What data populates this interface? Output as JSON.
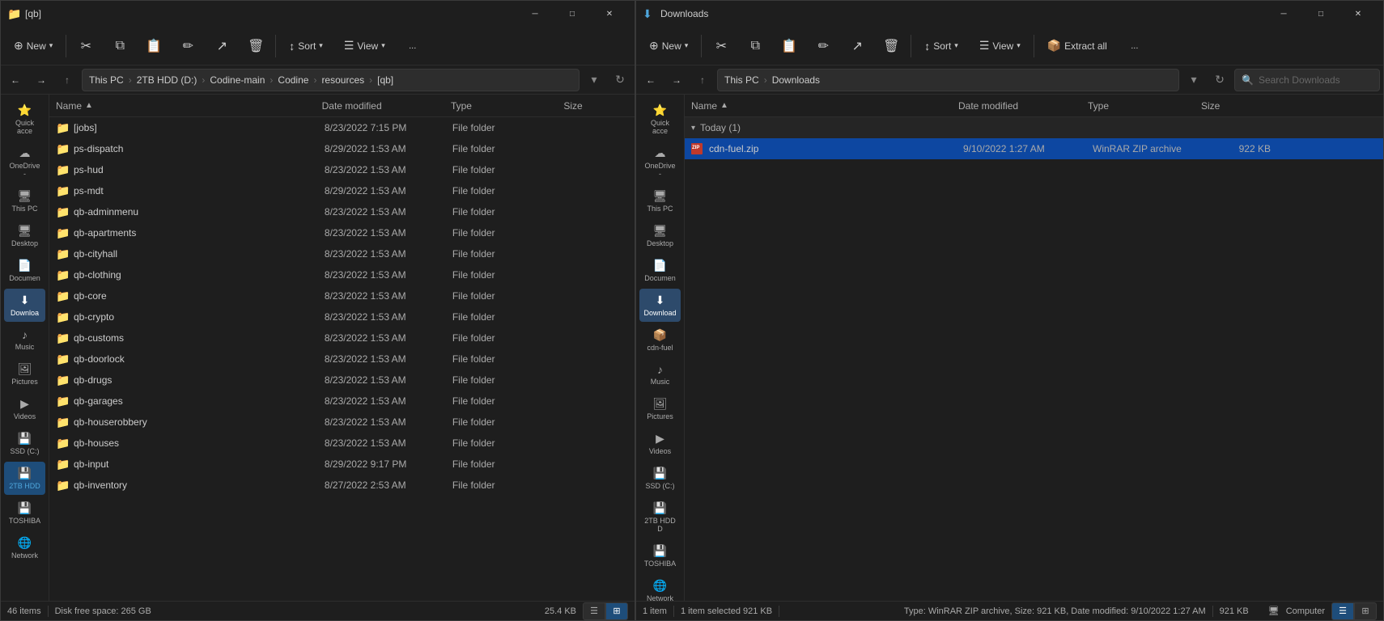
{
  "left_window": {
    "title": "[qb]",
    "title_icon": "📁",
    "toolbar": {
      "new_label": "New",
      "sort_label": "Sort",
      "view_label": "View",
      "more_label": "...",
      "buttons": [
        "cut",
        "copy",
        "paste",
        "rename",
        "share",
        "delete",
        "sort",
        "view",
        "more"
      ]
    },
    "breadcrumb": {
      "segments": [
        "This PC",
        "2TB HDD (D:)",
        "Codine-main",
        "Codine",
        "resources",
        "[qb]"
      ]
    },
    "columns": {
      "name": "Name",
      "date_modified": "Date modified",
      "type": "Type",
      "size": "Size"
    },
    "files": [
      {
        "name": "[jobs]",
        "date": "8/23/2022 7:15 PM",
        "type": "File folder",
        "size": ""
      },
      {
        "name": "ps-dispatch",
        "date": "8/29/2022 1:53 AM",
        "type": "File folder",
        "size": ""
      },
      {
        "name": "ps-hud",
        "date": "8/23/2022 1:53 AM",
        "type": "File folder",
        "size": ""
      },
      {
        "name": "ps-mdt",
        "date": "8/29/2022 1:53 AM",
        "type": "File folder",
        "size": ""
      },
      {
        "name": "qb-adminmenu",
        "date": "8/23/2022 1:53 AM",
        "type": "File folder",
        "size": ""
      },
      {
        "name": "qb-apartments",
        "date": "8/23/2022 1:53 AM",
        "type": "File folder",
        "size": ""
      },
      {
        "name": "qb-cityhall",
        "date": "8/23/2022 1:53 AM",
        "type": "File folder",
        "size": ""
      },
      {
        "name": "qb-clothing",
        "date": "8/23/2022 1:53 AM",
        "type": "File folder",
        "size": ""
      },
      {
        "name": "qb-core",
        "date": "8/23/2022 1:53 AM",
        "type": "File folder",
        "size": ""
      },
      {
        "name": "qb-crypto",
        "date": "8/23/2022 1:53 AM",
        "type": "File folder",
        "size": ""
      },
      {
        "name": "qb-customs",
        "date": "8/23/2022 1:53 AM",
        "type": "File folder",
        "size": ""
      },
      {
        "name": "qb-doorlock",
        "date": "8/23/2022 1:53 AM",
        "type": "File folder",
        "size": ""
      },
      {
        "name": "qb-drugs",
        "date": "8/23/2022 1:53 AM",
        "type": "File folder",
        "size": ""
      },
      {
        "name": "qb-garages",
        "date": "8/23/2022 1:53 AM",
        "type": "File folder",
        "size": ""
      },
      {
        "name": "qb-houserobbery",
        "date": "8/23/2022 1:53 AM",
        "type": "File folder",
        "size": ""
      },
      {
        "name": "qb-houses",
        "date": "8/23/2022 1:53 AM",
        "type": "File folder",
        "size": ""
      },
      {
        "name": "qb-input",
        "date": "8/29/2022 9:17 PM",
        "type": "File folder",
        "size": ""
      },
      {
        "name": "qb-inventory",
        "date": "8/27/2022 2:53 AM",
        "type": "File folder",
        "size": ""
      }
    ],
    "status": {
      "count": "46 items",
      "disk_free": "Disk free space: 265 GB",
      "size_info": "25.4 KB"
    },
    "sidebar_items": [
      {
        "label": "Quick acce",
        "icon": "⭐"
      },
      {
        "label": "OneDrive -",
        "icon": "☁"
      },
      {
        "label": "This PC",
        "icon": "🖥"
      },
      {
        "label": "Desktop",
        "icon": "🖥"
      },
      {
        "label": "Documen",
        "icon": "📄"
      },
      {
        "label": "Downloa",
        "icon": "⬇",
        "active": true
      },
      {
        "label": "Music",
        "icon": "♪"
      },
      {
        "label": "Pictures",
        "icon": "🖼"
      },
      {
        "label": "Videos",
        "icon": "▶"
      },
      {
        "label": "SSD (C:)",
        "icon": "💾"
      },
      {
        "label": "2TB HDD",
        "icon": "💾",
        "highlight": true
      },
      {
        "label": "TOSHIBA",
        "icon": "💾"
      },
      {
        "label": "Network",
        "icon": "🌐"
      }
    ]
  },
  "right_window": {
    "title": "Downloads",
    "title_icon": "⬇",
    "toolbar": {
      "new_label": "New",
      "sort_label": "Sort",
      "view_label": "View",
      "extract_label": "Extract all",
      "more_label": "..."
    },
    "breadcrumb": {
      "segments": [
        "This PC",
        "Downloads"
      ]
    },
    "search_placeholder": "Search Downloads",
    "columns": {
      "name": "Name",
      "date_modified": "Date modified",
      "type": "Type",
      "size": "Size"
    },
    "groups": [
      {
        "label": "Today (1)",
        "expanded": true,
        "files": [
          {
            "name": "cdn-fuel.zip",
            "date": "9/10/2022 1:27 AM",
            "type": "WinRAR ZIP archive",
            "size": "922 KB",
            "selected": true,
            "icon": "zip"
          }
        ]
      }
    ],
    "status": {
      "count": "1 item",
      "selected": "1 item selected  921 KB",
      "size_info": "921 KB",
      "file_info": "Type: WinRAR ZIP archive, Size: 921 KB, Date modified: 9/10/2022 1:27 AM",
      "computer_label": "Computer"
    },
    "sidebar_items": [
      {
        "label": "Quick acce",
        "icon": "⭐"
      },
      {
        "label": "OneDrive -",
        "icon": "☁"
      },
      {
        "label": "This PC",
        "icon": "🖥"
      },
      {
        "label": "Desktop",
        "icon": "🖥"
      },
      {
        "label": "Documen",
        "icon": "📄"
      },
      {
        "label": "Download",
        "icon": "⬇",
        "active": true
      },
      {
        "label": "cdn-fuel",
        "icon": "📦"
      },
      {
        "label": "Music",
        "icon": "♪"
      },
      {
        "label": "Pictures",
        "icon": "🖼"
      },
      {
        "label": "Videos",
        "icon": "▶"
      },
      {
        "label": "SSD (C:)",
        "icon": "💾"
      },
      {
        "label": "2TB HDD D",
        "icon": "💾"
      },
      {
        "label": "TOSHIBA",
        "icon": "💾"
      },
      {
        "label": "Network",
        "icon": "🌐"
      }
    ]
  }
}
